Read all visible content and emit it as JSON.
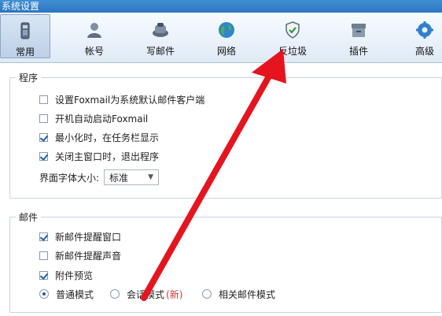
{
  "window": {
    "title": "系统设置"
  },
  "toolbar": {
    "items": [
      {
        "label": "常用",
        "icon": "phone-icon"
      },
      {
        "label": "帐号",
        "icon": "user-icon"
      },
      {
        "label": "写邮件",
        "icon": "compose-icon"
      },
      {
        "label": "网络",
        "icon": "globe-icon"
      },
      {
        "label": "反垃圾",
        "icon": "shield-icon"
      },
      {
        "label": "插件",
        "icon": "plugin-icon"
      },
      {
        "label": "高级",
        "icon": "gear-icon"
      }
    ],
    "active_index": 0
  },
  "program": {
    "legend": "程序",
    "options": [
      {
        "label": "设置Foxmail为系统默认邮件客户端",
        "checked": false
      },
      {
        "label": "开机自动启动Foxmail",
        "checked": false
      },
      {
        "label": "最小化时，在任务栏显示",
        "checked": true
      },
      {
        "label": "关闭主窗口时，退出程序",
        "checked": true
      }
    ],
    "font_size": {
      "label": "界面字体大小:",
      "value": "标准"
    }
  },
  "mail": {
    "legend": "邮件",
    "options": [
      {
        "label": "新邮件提醒窗口",
        "checked": true
      },
      {
        "label": "新邮件提醒声音",
        "checked": false
      },
      {
        "label": "附件预览",
        "checked": true
      }
    ],
    "modes": [
      {
        "label": "普通模式",
        "selected": true
      },
      {
        "label": "会话模式",
        "tag": "(新)",
        "selected": false
      },
      {
        "label": "相关邮件模式",
        "selected": false
      }
    ]
  },
  "colors": {
    "arrow": "#e4151f",
    "titlebar": "#2c76c2",
    "new_tag": "#d03b3b"
  }
}
